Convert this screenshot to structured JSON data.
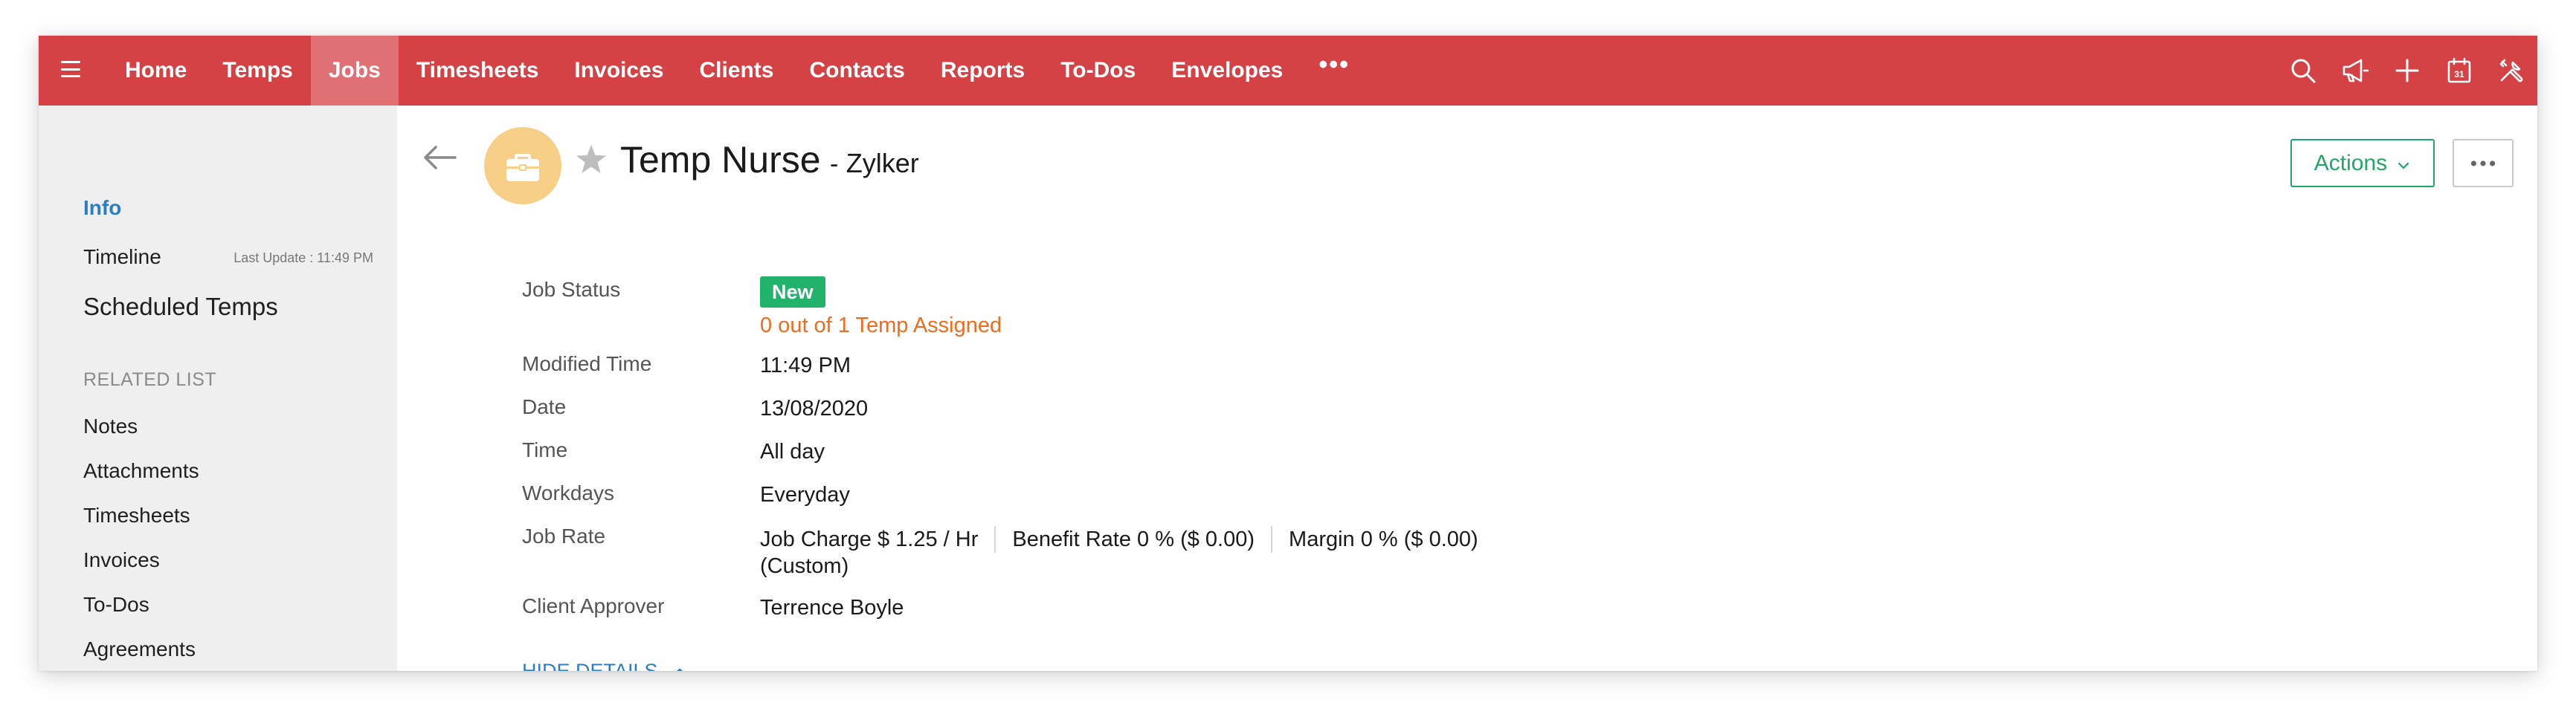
{
  "nav": {
    "tabs": [
      {
        "label": "Home"
      },
      {
        "label": "Temps"
      },
      {
        "label": "Jobs"
      },
      {
        "label": "Timesheets"
      },
      {
        "label": "Invoices"
      },
      {
        "label": "Clients"
      },
      {
        "label": "Contacts"
      },
      {
        "label": "Reports"
      },
      {
        "label": "To-Dos"
      },
      {
        "label": "Envelopes"
      }
    ],
    "active_tab": "Jobs",
    "more_label": "•••",
    "icons": [
      "search-icon",
      "megaphone-icon",
      "plus-icon",
      "calendar-icon",
      "tools-icon"
    ],
    "calendar_day": "31",
    "brand_color": "#d44245"
  },
  "sidebar": {
    "info": "Info",
    "timeline": "Timeline",
    "last_update": "Last Update : 11:49 PM",
    "scheduled_temps": "Scheduled Temps",
    "related_list_title": "RELATED LIST",
    "related": [
      "Notes",
      "Attachments",
      "Timesheets",
      "Invoices",
      "To-Dos",
      "Agreements"
    ]
  },
  "record": {
    "title": "Temp Nurse",
    "separator": "-",
    "client": "Zylker",
    "actions_label": "Actions",
    "more_label": "•••",
    "avatar_icon": "briefcase-icon",
    "star_icon": "star-icon",
    "back_icon": "back-arrow-icon"
  },
  "details": {
    "job_status_label": "Job Status",
    "job_status_value": "New",
    "assigned_text": "0 out of 1 Temp Assigned",
    "modified_time_label": "Modified Time",
    "modified_time_value": "11:49 PM",
    "date_label": "Date",
    "date_value": "13/08/2020",
    "time_label": "Time",
    "time_value": "All day",
    "workdays_label": "Workdays",
    "workdays_value": "Everyday",
    "job_rate_label": "Job Rate",
    "job_charge": "Job Charge $ 1.25 / Hr",
    "benefit_rate": "Benefit Rate 0 % ($ 0.00)",
    "margin": "Margin 0 % ($ 0.00)",
    "custom": "(Custom)",
    "client_approver_label": "Client Approver",
    "client_approver_value": "Terrence Boyle",
    "hide_details": "HIDE DETAILS"
  },
  "colors": {
    "accent_green": "#21b26b",
    "link_blue": "#2d7dc1",
    "assigned_orange": "#f26a1b",
    "avatar_bg": "#f7cf86"
  }
}
